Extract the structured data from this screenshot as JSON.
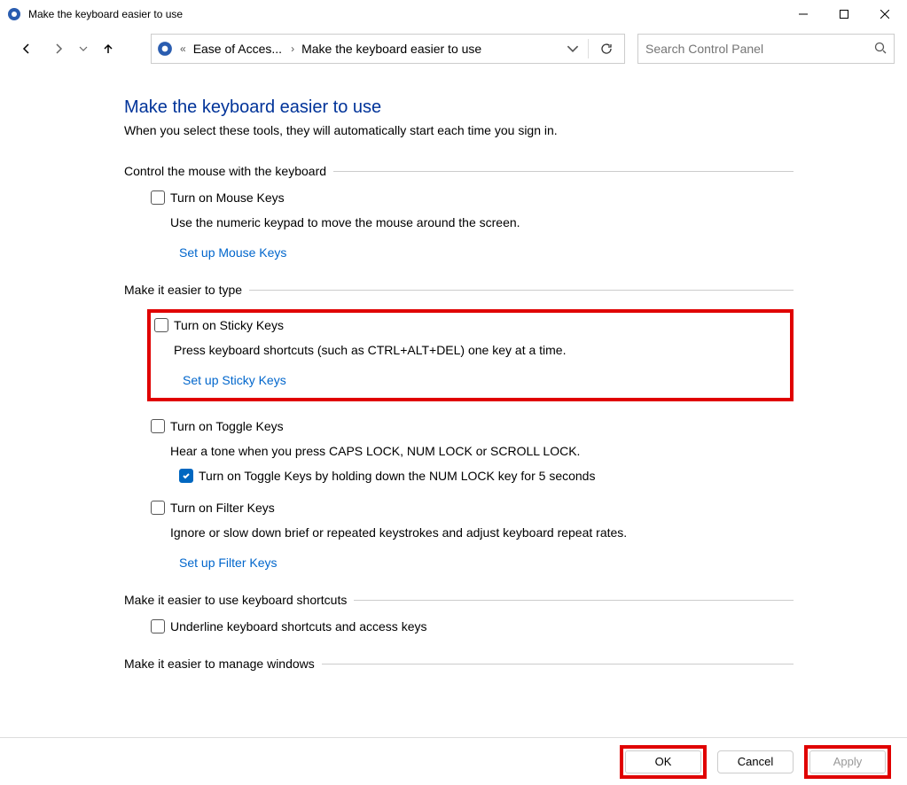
{
  "window": {
    "title": "Make the keyboard easier to use"
  },
  "breadcrumb": {
    "item1": "Ease of Acces...",
    "item2": "Make the keyboard easier to use"
  },
  "search": {
    "placeholder": "Search Control Panel"
  },
  "page": {
    "title": "Make the keyboard easier to use",
    "subtitle": "When you select these tools, they will automatically start each time you sign in."
  },
  "sections": {
    "mouse": {
      "title": "Control the mouse with the keyboard",
      "mouse_keys": {
        "label": "Turn on Mouse Keys",
        "desc": "Use the numeric keypad to move the mouse around the screen.",
        "link": "Set up Mouse Keys",
        "checked": false
      }
    },
    "type": {
      "title": "Make it easier to type",
      "sticky": {
        "label": "Turn on Sticky Keys",
        "desc": "Press keyboard shortcuts (such as CTRL+ALT+DEL) one key at a time.",
        "link": "Set up Sticky Keys",
        "checked": false
      },
      "toggle": {
        "label": "Turn on Toggle Keys",
        "desc": "Hear a tone when you press CAPS LOCK, NUM LOCK or SCROLL LOCK.",
        "sub_label": "Turn on Toggle Keys by holding down the NUM LOCK key for 5 seconds",
        "checked": false,
        "sub_checked": true
      },
      "filter": {
        "label": "Turn on Filter Keys",
        "desc": "Ignore or slow down brief or repeated keystrokes and adjust keyboard repeat rates.",
        "link": "Set up Filter Keys",
        "checked": false
      }
    },
    "shortcuts": {
      "title": "Make it easier to use keyboard shortcuts",
      "underline": {
        "label": "Underline keyboard shortcuts and access keys",
        "checked": false
      }
    },
    "windows": {
      "title": "Make it easier to manage windows"
    }
  },
  "footer": {
    "ok": "OK",
    "cancel": "Cancel",
    "apply": "Apply"
  }
}
